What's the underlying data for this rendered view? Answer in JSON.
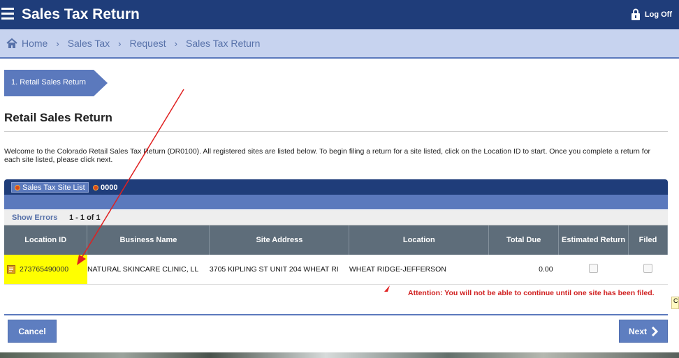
{
  "app": {
    "title": "Sales Tax Return",
    "logoff_label": "Log Off",
    "colors": {
      "header": "#1f3d7a",
      "breadcrumb": "#c7d3ef",
      "accent": "#5b79bd",
      "highlight": "#ffff00",
      "error": "#d02020"
    }
  },
  "breadcrumb": [
    "Home",
    "Sales Tax",
    "Request",
    "Sales Tax Return"
  ],
  "step": {
    "label": "1. Retail Sales Return"
  },
  "page": {
    "title": "Retail Sales Return",
    "intro": "Welcome to the Colorado Retail Sales Tax Return (DR0100). All registered sites are listed below. To begin filing a return for a site listed, click on the Location ID to start. Once you complete a return for each site listed, please click next."
  },
  "tabs": {
    "site_list": "Sales Tax Site List",
    "second": "0000"
  },
  "toolbar": {
    "show_errors": "Show Errors",
    "pager": "1 - 1 of 1"
  },
  "table": {
    "headers": [
      "Location ID",
      "Business Name",
      "Site Address",
      "Location",
      "Total Due",
      "Estimated Return",
      "Filed"
    ],
    "rows": [
      {
        "location_id": "273765490000",
        "business_name": "NATURAL SKINCARE CLINIC, LL",
        "site_address": "3705 KIPLING ST UNIT 204 WHEAT RI",
        "location": "WHEAT RIDGE-JEFFERSON",
        "total_due": "0.00",
        "estimated_return": false,
        "filed": false
      }
    ]
  },
  "attention": "Attention: You will not be able to continue until one site has been filed.",
  "flag_text": "C",
  "buttons": {
    "cancel": "Cancel",
    "next": "Next"
  }
}
